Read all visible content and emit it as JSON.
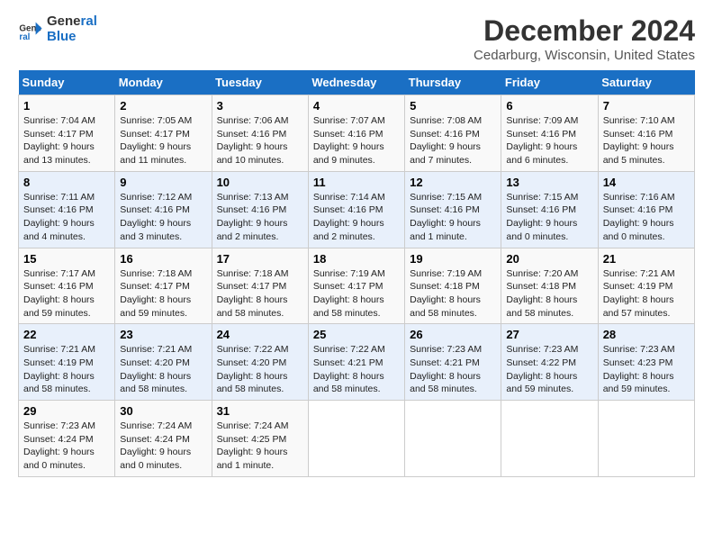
{
  "logo": {
    "line1": "General",
    "line2": "Blue"
  },
  "title": "December 2024",
  "subtitle": "Cedarburg, Wisconsin, United States",
  "days_header": [
    "Sunday",
    "Monday",
    "Tuesday",
    "Wednesday",
    "Thursday",
    "Friday",
    "Saturday"
  ],
  "weeks": [
    [
      {
        "day": "1",
        "info": "Sunrise: 7:04 AM\nSunset: 4:17 PM\nDaylight: 9 hours\nand 13 minutes."
      },
      {
        "day": "2",
        "info": "Sunrise: 7:05 AM\nSunset: 4:17 PM\nDaylight: 9 hours\nand 11 minutes."
      },
      {
        "day": "3",
        "info": "Sunrise: 7:06 AM\nSunset: 4:16 PM\nDaylight: 9 hours\nand 10 minutes."
      },
      {
        "day": "4",
        "info": "Sunrise: 7:07 AM\nSunset: 4:16 PM\nDaylight: 9 hours\nand 9 minutes."
      },
      {
        "day": "5",
        "info": "Sunrise: 7:08 AM\nSunset: 4:16 PM\nDaylight: 9 hours\nand 7 minutes."
      },
      {
        "day": "6",
        "info": "Sunrise: 7:09 AM\nSunset: 4:16 PM\nDaylight: 9 hours\nand 6 minutes."
      },
      {
        "day": "7",
        "info": "Sunrise: 7:10 AM\nSunset: 4:16 PM\nDaylight: 9 hours\nand 5 minutes."
      }
    ],
    [
      {
        "day": "8",
        "info": "Sunrise: 7:11 AM\nSunset: 4:16 PM\nDaylight: 9 hours\nand 4 minutes."
      },
      {
        "day": "9",
        "info": "Sunrise: 7:12 AM\nSunset: 4:16 PM\nDaylight: 9 hours\nand 3 minutes."
      },
      {
        "day": "10",
        "info": "Sunrise: 7:13 AM\nSunset: 4:16 PM\nDaylight: 9 hours\nand 2 minutes."
      },
      {
        "day": "11",
        "info": "Sunrise: 7:14 AM\nSunset: 4:16 PM\nDaylight: 9 hours\nand 2 minutes."
      },
      {
        "day": "12",
        "info": "Sunrise: 7:15 AM\nSunset: 4:16 PM\nDaylight: 9 hours\nand 1 minute."
      },
      {
        "day": "13",
        "info": "Sunrise: 7:15 AM\nSunset: 4:16 PM\nDaylight: 9 hours\nand 0 minutes."
      },
      {
        "day": "14",
        "info": "Sunrise: 7:16 AM\nSunset: 4:16 PM\nDaylight: 9 hours\nand 0 minutes."
      }
    ],
    [
      {
        "day": "15",
        "info": "Sunrise: 7:17 AM\nSunset: 4:16 PM\nDaylight: 8 hours\nand 59 minutes."
      },
      {
        "day": "16",
        "info": "Sunrise: 7:18 AM\nSunset: 4:17 PM\nDaylight: 8 hours\nand 59 minutes."
      },
      {
        "day": "17",
        "info": "Sunrise: 7:18 AM\nSunset: 4:17 PM\nDaylight: 8 hours\nand 58 minutes."
      },
      {
        "day": "18",
        "info": "Sunrise: 7:19 AM\nSunset: 4:17 PM\nDaylight: 8 hours\nand 58 minutes."
      },
      {
        "day": "19",
        "info": "Sunrise: 7:19 AM\nSunset: 4:18 PM\nDaylight: 8 hours\nand 58 minutes."
      },
      {
        "day": "20",
        "info": "Sunrise: 7:20 AM\nSunset: 4:18 PM\nDaylight: 8 hours\nand 58 minutes."
      },
      {
        "day": "21",
        "info": "Sunrise: 7:21 AM\nSunset: 4:19 PM\nDaylight: 8 hours\nand 57 minutes."
      }
    ],
    [
      {
        "day": "22",
        "info": "Sunrise: 7:21 AM\nSunset: 4:19 PM\nDaylight: 8 hours\nand 58 minutes."
      },
      {
        "day": "23",
        "info": "Sunrise: 7:21 AM\nSunset: 4:20 PM\nDaylight: 8 hours\nand 58 minutes."
      },
      {
        "day": "24",
        "info": "Sunrise: 7:22 AM\nSunset: 4:20 PM\nDaylight: 8 hours\nand 58 minutes."
      },
      {
        "day": "25",
        "info": "Sunrise: 7:22 AM\nSunset: 4:21 PM\nDaylight: 8 hours\nand 58 minutes."
      },
      {
        "day": "26",
        "info": "Sunrise: 7:23 AM\nSunset: 4:21 PM\nDaylight: 8 hours\nand 58 minutes."
      },
      {
        "day": "27",
        "info": "Sunrise: 7:23 AM\nSunset: 4:22 PM\nDaylight: 8 hours\nand 59 minutes."
      },
      {
        "day": "28",
        "info": "Sunrise: 7:23 AM\nSunset: 4:23 PM\nDaylight: 8 hours\nand 59 minutes."
      }
    ],
    [
      {
        "day": "29",
        "info": "Sunrise: 7:23 AM\nSunset: 4:24 PM\nDaylight: 9 hours\nand 0 minutes."
      },
      {
        "day": "30",
        "info": "Sunrise: 7:24 AM\nSunset: 4:24 PM\nDaylight: 9 hours\nand 0 minutes."
      },
      {
        "day": "31",
        "info": "Sunrise: 7:24 AM\nSunset: 4:25 PM\nDaylight: 9 hours\nand 1 minute."
      },
      {
        "day": "",
        "info": ""
      },
      {
        "day": "",
        "info": ""
      },
      {
        "day": "",
        "info": ""
      },
      {
        "day": "",
        "info": ""
      }
    ]
  ]
}
